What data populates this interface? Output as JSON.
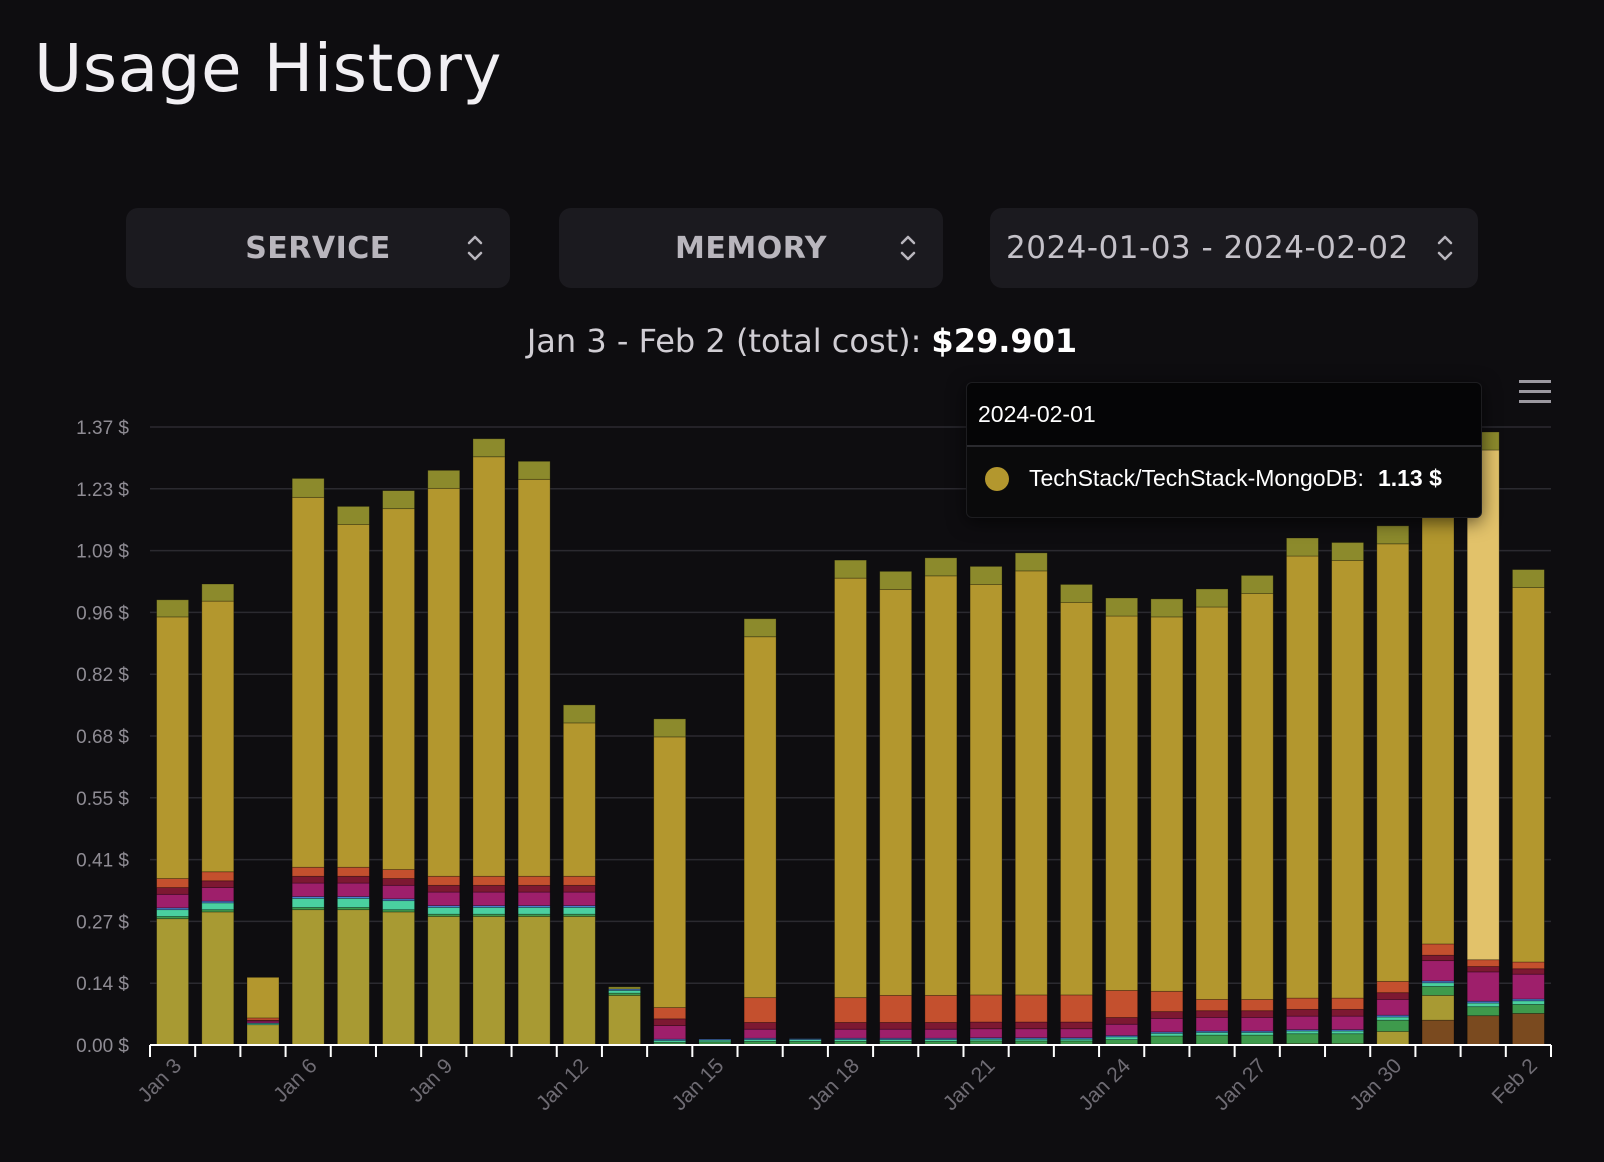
{
  "page": {
    "title": "Usage History"
  },
  "filters": {
    "group_by": "SERVICE",
    "resource": "MEMORY",
    "date_range": "2024-01-03 - 2024-02-02"
  },
  "summary": {
    "label": "Jan 3 - Feb 2 (total cost):",
    "total": "$29.901"
  },
  "tooltip": {
    "date": "2024-02-01",
    "series": "TechStack/TechStack-MongoDB:",
    "value": "1.13 $",
    "color": "#b3972e"
  },
  "chart_data": {
    "type": "bar",
    "stacked": true,
    "title": "",
    "xlabel": "",
    "ylabel": "",
    "ylim": [
      0,
      1.37
    ],
    "y_ticks": [
      "0.00 $",
      "0.14 $",
      "0.27 $",
      "0.41 $",
      "0.55 $",
      "0.68 $",
      "0.82 $",
      "0.96 $",
      "1.09 $",
      "1.23 $",
      "1.37 $"
    ],
    "y_tick_values": [
      0,
      0.137,
      0.274,
      0.411,
      0.548,
      0.685,
      0.822,
      0.959,
      1.096,
      1.233,
      1.37
    ],
    "x_tick_labels": [
      {
        "index": 0,
        "label": "Jan 3"
      },
      {
        "index": 3,
        "label": "Jan 6"
      },
      {
        "index": 6,
        "label": "Jan 9"
      },
      {
        "index": 9,
        "label": "Jan 12"
      },
      {
        "index": 12,
        "label": "Jan 15"
      },
      {
        "index": 15,
        "label": "Jan 18"
      },
      {
        "index": 18,
        "label": "Jan 21"
      },
      {
        "index": 21,
        "label": "Jan 24"
      },
      {
        "index": 24,
        "label": "Jan 27"
      },
      {
        "index": 27,
        "label": "Jan 30"
      },
      {
        "index": 30,
        "label": "Feb 2"
      }
    ],
    "highlight_index": 29,
    "categories": [
      "2024-01-03",
      "2024-01-04",
      "2024-01-05",
      "2024-01-06",
      "2024-01-07",
      "2024-01-08",
      "2024-01-09",
      "2024-01-10",
      "2024-01-11",
      "2024-01-12",
      "2024-01-13",
      "2024-01-14",
      "2024-01-15",
      "2024-01-16",
      "2024-01-17",
      "2024-01-18",
      "2024-01-19",
      "2024-01-20",
      "2024-01-21",
      "2024-01-22",
      "2024-01-23",
      "2024-01-24",
      "2024-01-25",
      "2024-01-26",
      "2024-01-27",
      "2024-01-28",
      "2024-01-29",
      "2024-01-30",
      "2024-01-31",
      "2024-02-01",
      "2024-02-02"
    ],
    "series": [
      {
        "color": "#7a4a1f",
        "values": [
          0,
          0,
          0,
          0,
          0,
          0,
          0,
          0,
          0,
          0,
          0,
          0,
          0,
          0,
          0,
          0,
          0,
          0,
          0,
          0,
          0,
          0,
          0,
          0,
          0,
          0,
          0,
          0,
          0.055,
          0.065,
          0.07
        ]
      },
      {
        "color": "#a89a33",
        "values": [
          0.28,
          0.295,
          0.045,
          0.3,
          0.3,
          0.295,
          0.285,
          0.285,
          0.285,
          0.285,
          0.11,
          0.002,
          0.002,
          0.002,
          0.002,
          0.002,
          0.002,
          0.002,
          0.002,
          0.002,
          0.002,
          0.002,
          0.002,
          0.002,
          0.002,
          0.003,
          0.003,
          0.03,
          0.055,
          0,
          0
        ]
      },
      {
        "color": "#3e9a4c",
        "values": [
          0.005,
          0.005,
          0,
          0.005,
          0.005,
          0.005,
          0.005,
          0.005,
          0.005,
          0.005,
          0.005,
          0.004,
          0.005,
          0.006,
          0.006,
          0.006,
          0.006,
          0.006,
          0.007,
          0.007,
          0.007,
          0.01,
          0.018,
          0.02,
          0.02,
          0.022,
          0.022,
          0.025,
          0.02,
          0.02,
          0.02
        ]
      },
      {
        "color": "#4ad0a0",
        "values": [
          0.015,
          0.015,
          0.003,
          0.02,
          0.02,
          0.02,
          0.015,
          0.015,
          0.015,
          0.015,
          0.006,
          0.004,
          0.004,
          0.004,
          0.004,
          0.004,
          0.004,
          0.004,
          0.004,
          0.004,
          0.004,
          0.006,
          0.006,
          0.006,
          0.006,
          0.006,
          0.006,
          0.007,
          0.008,
          0.008,
          0.008
        ]
      },
      {
        "color": "#4a7fd0",
        "values": [
          0.004,
          0.004,
          0.001,
          0.004,
          0.004,
          0.004,
          0.004,
          0.004,
          0.004,
          0.004,
          0.003,
          0.003,
          0.002,
          0.003,
          0.002,
          0.003,
          0.003,
          0.003,
          0.003,
          0.003,
          0.003,
          0.003,
          0.003,
          0.003,
          0.003,
          0.003,
          0.003,
          0.004,
          0.004,
          0.004,
          0.004
        ]
      },
      {
        "color": "#9e1f6b",
        "values": [
          0.03,
          0.03,
          0.004,
          0.03,
          0.03,
          0.03,
          0.03,
          0.03,
          0.03,
          0.03,
          0,
          0.03,
          0,
          0.02,
          0,
          0.02,
          0.02,
          0.02,
          0.02,
          0.02,
          0.02,
          0.025,
          0.03,
          0.03,
          0.03,
          0.03,
          0.03,
          0.035,
          0.045,
          0.065,
          0.055
        ]
      },
      {
        "color": "#7d1832",
        "values": [
          0.015,
          0.015,
          0.002,
          0.015,
          0.015,
          0.015,
          0.015,
          0.015,
          0.015,
          0.015,
          0,
          0.015,
          0,
          0.015,
          0,
          0.015,
          0.015,
          0.015,
          0.015,
          0.015,
          0.015,
          0.015,
          0.015,
          0.015,
          0.015,
          0.015,
          0.015,
          0.015,
          0.012,
          0.012,
          0.012
        ]
      },
      {
        "color": "#c4502e",
        "values": [
          0.02,
          0.02,
          0.005,
          0.02,
          0.02,
          0.02,
          0.02,
          0.02,
          0.02,
          0.02,
          0,
          0.025,
          0,
          0.055,
          0,
          0.055,
          0.06,
          0.06,
          0.06,
          0.06,
          0.06,
          0.06,
          0.045,
          0.025,
          0.025,
          0.025,
          0.025,
          0.025,
          0.025,
          0.015,
          0.015
        ]
      },
      {
        "color": "#b3972e",
        "values": [
          0.58,
          0.6,
          0.09,
          0.82,
          0.76,
          0.8,
          0.86,
          0.93,
          0.88,
          0.34,
          0,
          0.6,
          0,
          0.8,
          0,
          0.93,
          0.9,
          0.93,
          0.91,
          0.94,
          0.87,
          0.83,
          0.83,
          0.87,
          0.9,
          0.98,
          0.97,
          0.97,
          1.02,
          1.13,
          0.83
        ]
      },
      {
        "color": "#8c8a2c",
        "values": [
          0.038,
          0.038,
          0,
          0.042,
          0.04,
          0.04,
          0.04,
          0.04,
          0.04,
          0.04,
          0.005,
          0.04,
          0,
          0.04,
          0,
          0.04,
          0.04,
          0.04,
          0.04,
          0.04,
          0.04,
          0.04,
          0.04,
          0.04,
          0.04,
          0.04,
          0.04,
          0.04,
          0.04,
          0.04,
          0.04
        ]
      }
    ]
  }
}
